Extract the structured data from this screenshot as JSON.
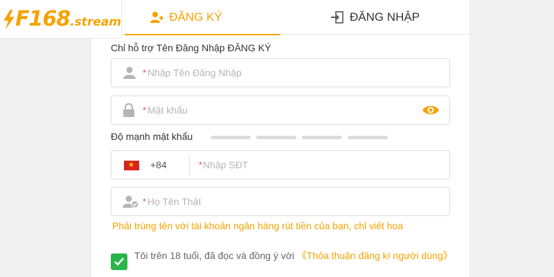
{
  "brand": {
    "logo_main": "F168",
    "logo_sub": ".stream",
    "color": "#f5a300"
  },
  "tabs": [
    {
      "label": "ĐĂNG KÝ",
      "active": true,
      "icon": "user-add-icon"
    },
    {
      "label": "ĐĂNG NHẬP",
      "active": false,
      "icon": "login-door-icon"
    }
  ],
  "form": {
    "hint": "Chỉ hỗ trợ Tên Đăng Nhập ĐĂNG KÝ",
    "required_mark": "*",
    "username": {
      "placeholder": "Nhập Tên Đăng Nhập",
      "value": "",
      "icon": "user-icon"
    },
    "password": {
      "placeholder": "Mật khẩu",
      "value": "",
      "icon": "lock-icon",
      "toggle_icon": "eye-icon"
    },
    "strength": {
      "label": "Độ mạnh mật khẩu",
      "levels": 4,
      "filled": 0
    },
    "phone": {
      "country_code": "+84",
      "flag_icon": "vietnam-flag-icon",
      "placeholder": "Nhập SĐT",
      "value": ""
    },
    "fullname": {
      "placeholder": "Họ Tên Thật",
      "value": "",
      "icon": "user-verified-icon"
    },
    "fullname_warning": "Phải trùng tên với tài khoản ngân hàng rút tiền của bạn, chỉ viết hoa",
    "agreement": {
      "checked": true,
      "text": "Tôi trên 18 tuổi, đã đọc và đồng ý với",
      "link": "《Thỏa thuận đăng kí người dùng》"
    }
  },
  "colors": {
    "accent": "#f5a300",
    "required": "#e74c3c",
    "check": "#2ab54a"
  }
}
